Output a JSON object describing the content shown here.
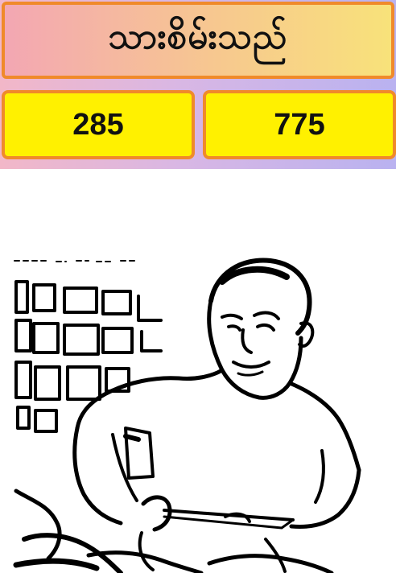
{
  "header": {
    "title": "သားစိမ်းသည်"
  },
  "scores": {
    "left": "285",
    "right": "775"
  },
  "colors": {
    "border": "#f08a2a",
    "score_background": "#fff100",
    "title_gradient": [
      "#f3a7b3",
      "#f8e27a"
    ]
  },
  "illustration": {
    "icon": "butcher-cutting-meat-sketch"
  }
}
